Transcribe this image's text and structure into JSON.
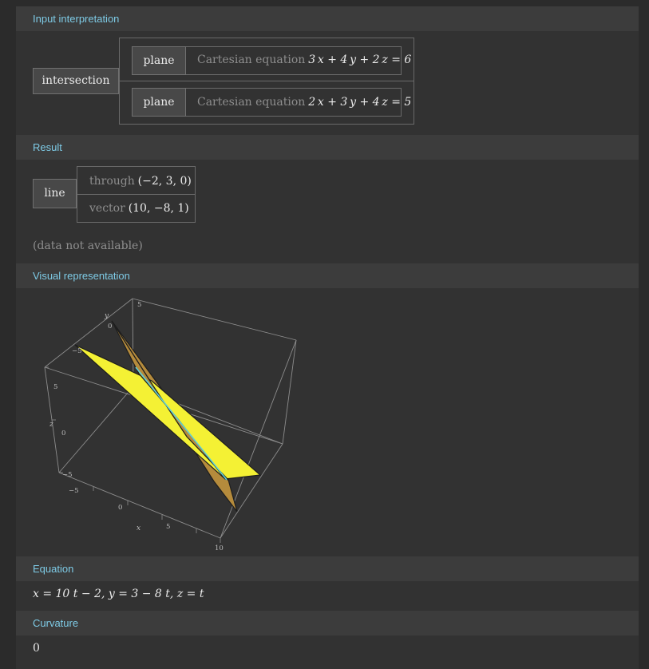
{
  "pods": {
    "input": "Input interpretation",
    "result": "Result",
    "visual": "Visual representation",
    "equation": "Equation",
    "curvature": "Curvature"
  },
  "input": {
    "intersection": "intersection",
    "planes": [
      {
        "label": "plane",
        "desc": "Cartesian equation",
        "eq": "3 x + 4 y + 2 z = 6"
      },
      {
        "label": "plane",
        "desc": "Cartesian equation",
        "eq": "2 x + 3 y + 4 z = 5"
      }
    ]
  },
  "result": {
    "label": "line",
    "through_label": "through",
    "through_value": "(−2, 3, 0)",
    "vector_label": "vector",
    "vector_value": "(10, −8, 1)",
    "note": "(data not available)"
  },
  "plot": {
    "y_axis_label": "y",
    "z_axis_label": "z",
    "x_axis_label": "x",
    "y_ticks": [
      "5",
      "0",
      "−5"
    ],
    "z_ticks": [
      "5",
      "0",
      "−5"
    ],
    "x_ticks": [
      "−5",
      "0",
      "5",
      "10"
    ],
    "plane_colors": {
      "plane1": "#f4f134",
      "plane2": "#b58b3c",
      "line": "#5fd0d8"
    }
  },
  "equation": {
    "text": "x = 10 t − 2, y = 3 − 8 t, z = t"
  },
  "curvature": {
    "value": "0"
  }
}
